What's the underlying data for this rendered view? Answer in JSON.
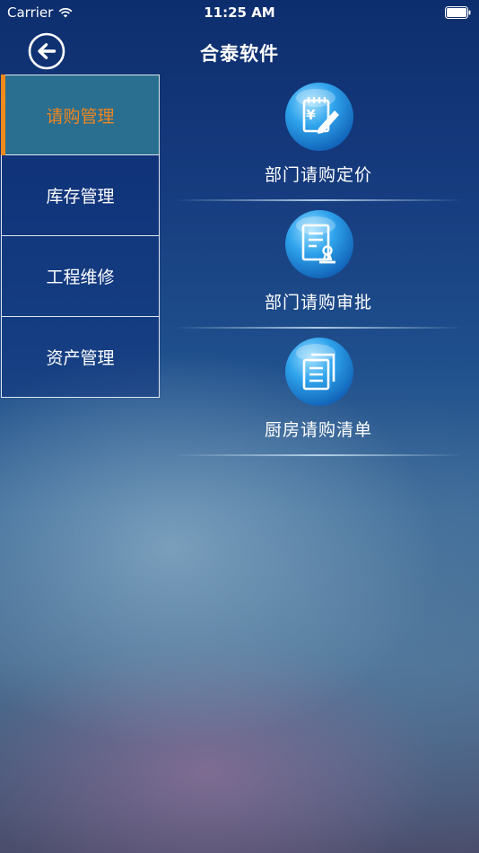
{
  "status_bar": {
    "carrier": "Carrier",
    "time": "11:25 AM"
  },
  "nav": {
    "title": "合泰软件",
    "back_icon": "back-arrow-icon"
  },
  "sidebar": {
    "items": [
      {
        "label": "请购管理",
        "active": true
      },
      {
        "label": "库存管理",
        "active": false
      },
      {
        "label": "工程维修",
        "active": false
      },
      {
        "label": "资产管理",
        "active": false
      }
    ]
  },
  "menu": {
    "items": [
      {
        "label": "部门请购定价",
        "icon": "pricing-edit-icon"
      },
      {
        "label": "部门请购审批",
        "icon": "approval-stamp-icon"
      },
      {
        "label": "厨房请购清单",
        "icon": "document-list-icon"
      }
    ]
  },
  "colors": {
    "accent_orange": "#f08a1c",
    "active_item_bg": "#2a6f8f",
    "icon_blue": "#1f8fe0"
  }
}
